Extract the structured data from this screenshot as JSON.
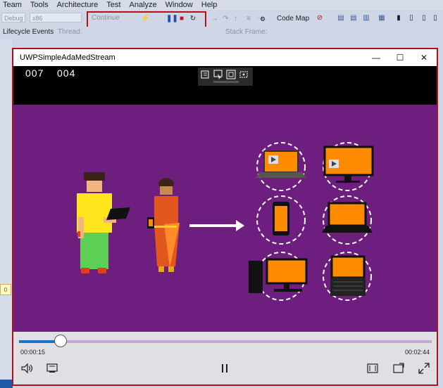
{
  "vs": {
    "menu": [
      "Team",
      "Tools",
      "Architecture",
      "Test",
      "Analyze",
      "Window",
      "Help"
    ],
    "toolbar": {
      "continue_label": "Continue",
      "codemap_label": "Code Map",
      "lifecycle_label": "Lifecycle Events",
      "thread_label": "Thread:",
      "stackframe_label": "Stack Frame:",
      "combo1": "Debug",
      "combo2": "x86"
    },
    "side_tab_label": "0"
  },
  "app": {
    "title": "UWPSimpleAdaMedStream",
    "window_controls": {
      "minimize": "—",
      "maximize": "☐",
      "close": "✕"
    },
    "timecode_left": "007",
    "timecode_right": "004",
    "player": {
      "position_time": "00:00:15",
      "duration_time": "00:02:44",
      "progress": 0.1,
      "controls": [
        "volume-icon",
        "cast-icon",
        "pause-icon",
        "aspect-ratio-icon",
        "picture-in-picture-icon",
        "fullscreen-icon"
      ]
    }
  },
  "colors": {
    "accent_red": "#b0121b",
    "video_purple": "#6e1e7e",
    "device_orange": "#ff8c00",
    "progress_blue": "#1a73c9",
    "progress_track": "#c9a6d6"
  }
}
